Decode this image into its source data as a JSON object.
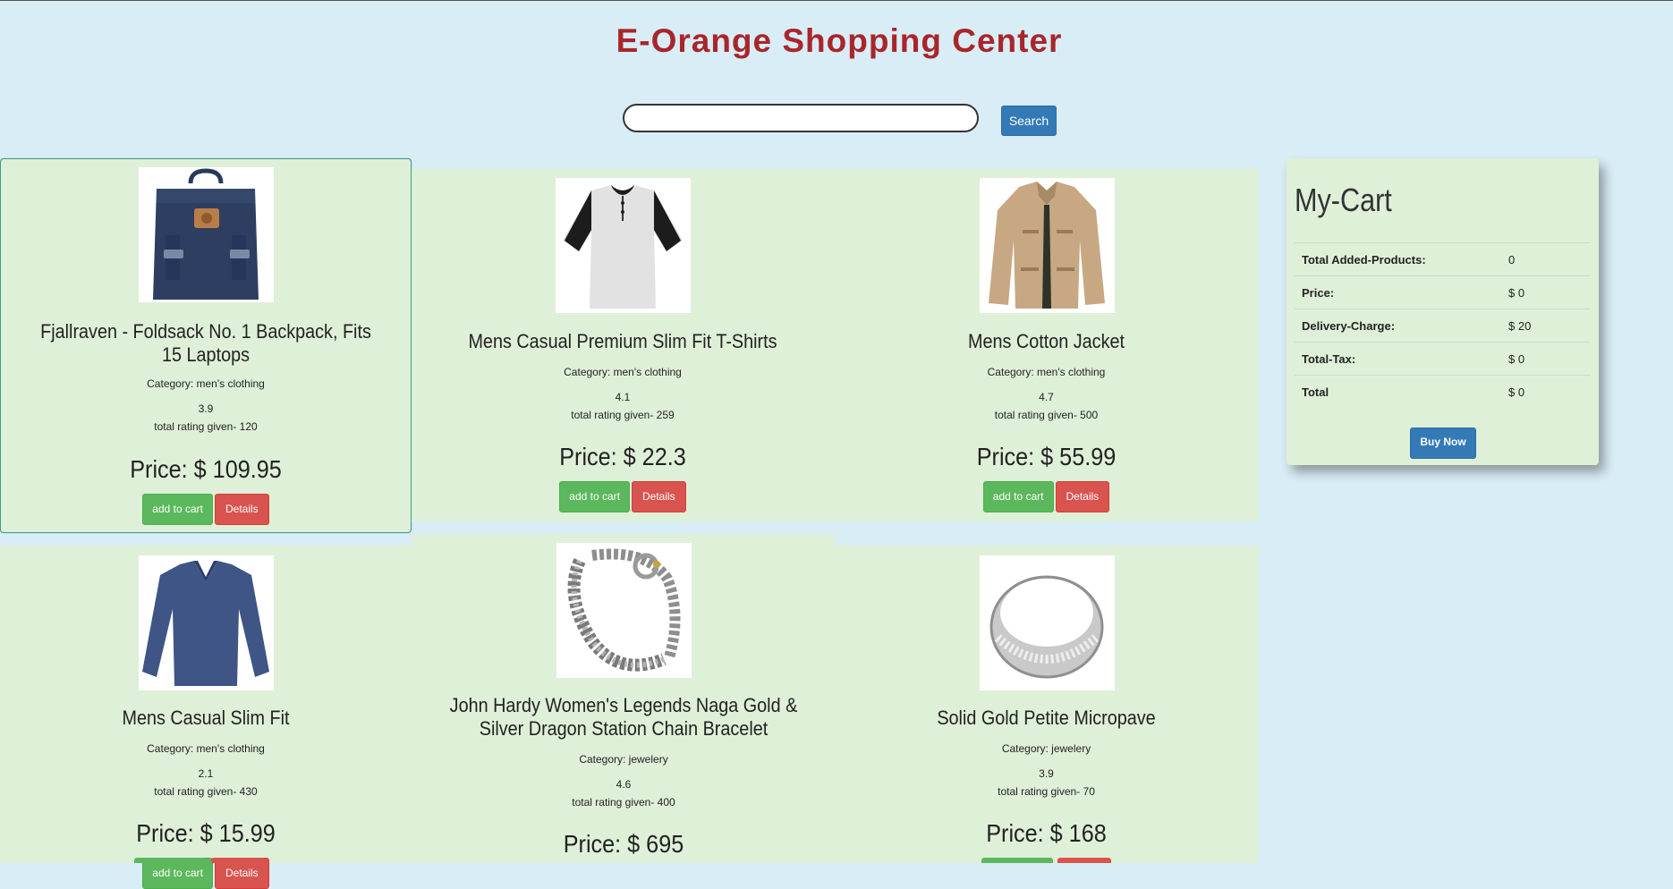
{
  "header": {
    "title": "E-Orange Shopping Center"
  },
  "search": {
    "value": "",
    "placeholder": "",
    "button_label": "Search"
  },
  "labels": {
    "category_prefix": "Category: ",
    "rating_count_prefix": "total rating given- ",
    "price_prefix": "Price: $ ",
    "add_to_cart": "add to cart",
    "details": "Details"
  },
  "products": [
    {
      "title": "Fjallraven - Foldsack No. 1 Backpack, Fits 15 Laptops",
      "category": "men's clothing",
      "rating": "3.9",
      "rating_count": "120",
      "price": "109.95",
      "image": "backpack-image"
    },
    {
      "title": "Mens Casual Premium Slim Fit T-Shirts",
      "category": "men's clothing",
      "rating": "4.1",
      "rating_count": "259",
      "price": "22.3",
      "image": "tshirt-image"
    },
    {
      "title": "Mens Cotton Jacket",
      "category": "men's clothing",
      "rating": "4.7",
      "rating_count": "500",
      "price": "55.99",
      "image": "jacket-image"
    },
    {
      "title": "Mens Casual Slim Fit",
      "category": "men's clothing",
      "rating": "2.1",
      "rating_count": "430",
      "price": "15.99",
      "image": "longsleeve-image"
    },
    {
      "title": "John Hardy Women's Legends Naga Gold & Silver Dragon Station Chain Bracelet",
      "category": "jewelery",
      "rating": "4.6",
      "rating_count": "400",
      "price": "695",
      "image": "bracelet-image"
    },
    {
      "title": "Solid Gold Petite Micropave",
      "category": "jewelery",
      "rating": "3.9",
      "rating_count": "70",
      "price": "168",
      "image": "ring-image"
    }
  ],
  "cart": {
    "title": "My-Cart",
    "rows": [
      {
        "label": "Total Added-Products:",
        "value": "0"
      },
      {
        "label": "Price:",
        "value": "$ 0"
      },
      {
        "label": "Delivery-Charge:",
        "value": "$ 20"
      },
      {
        "label": "Total-Tax:",
        "value": "$ 0"
      },
      {
        "label": "Total",
        "value": "$ 0"
      }
    ],
    "buy_label": "Buy Now"
  },
  "colors": {
    "page_bg": "#d9edf6",
    "card_bg": "#dff0d8",
    "title": "#a8262b",
    "primary": "#337ab7",
    "success": "#5cb85c",
    "danger": "#d9534f"
  }
}
